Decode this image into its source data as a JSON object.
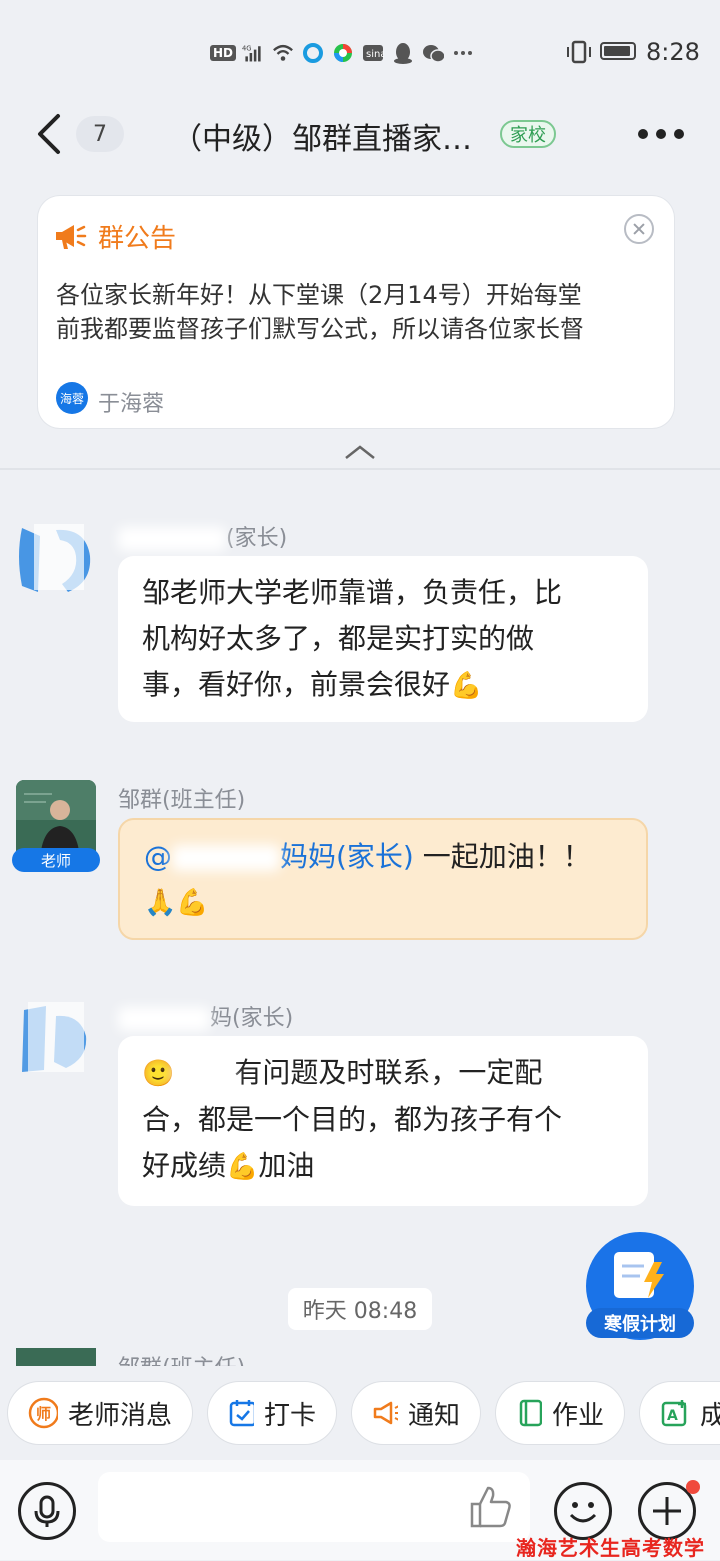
{
  "status_bar": {
    "time": "8:28",
    "icons": [
      "hd-icon",
      "signal-4g-icon",
      "wifi-icon",
      "app-icon",
      "app-icon",
      "weibo-icon",
      "qq-icon",
      "wechat-icon",
      "more-icon"
    ],
    "hd": "HD",
    "network": "4G"
  },
  "header": {
    "unread_count": "7",
    "title": "（中级）邹群直播家…",
    "badge": "家校"
  },
  "announcement": {
    "title": "群公告",
    "line1": "各位家长新年好！从下堂课（2月14号）开始每堂",
    "line2": "前我都要监督孩子们默写公式，所以请各位家长督",
    "author_avatar": "海蓉",
    "author": "于海蓉"
  },
  "messages": [
    {
      "sender_suffix": "(家长)",
      "lines": [
        "邹老师大学老师靠谱，负责任，比",
        "机构好太多了，都是实打实的做",
        "事，看好你，前景会很好"
      ],
      "emoji": "💪"
    },
    {
      "sender": "邹群(班主任)",
      "tag": "老师",
      "mention_prefix": "@",
      "mention_suffix": "妈妈(家长)",
      "text": " 一起加油！！",
      "emoji": "🙏💪"
    },
    {
      "sender_suffix": "妈(家长)",
      "lead_emoji": "🙂",
      "line1": "有问题及时联系，一定配",
      "line2": "合，都是一个目的，都为孩子有个",
      "line3_a": "好成绩",
      "line3_emoji": "💪",
      "line3_b": "加油"
    }
  ],
  "timestamp": "昨天 08:48",
  "partial_sender": "邹群(班主任)",
  "winter_plan": "寒假计划",
  "quick_actions": [
    "老师消息",
    "打卡",
    "通知",
    "作业",
    "成"
  ],
  "input": {
    "placeholder": ""
  },
  "watermark": "瀚海艺术生高考数学",
  "colors": {
    "accent_blue": "#1677e6",
    "announce_orange": "#f07b1c",
    "school_green": "#2e9d52",
    "teacher_bubble": "#fdebd0"
  }
}
